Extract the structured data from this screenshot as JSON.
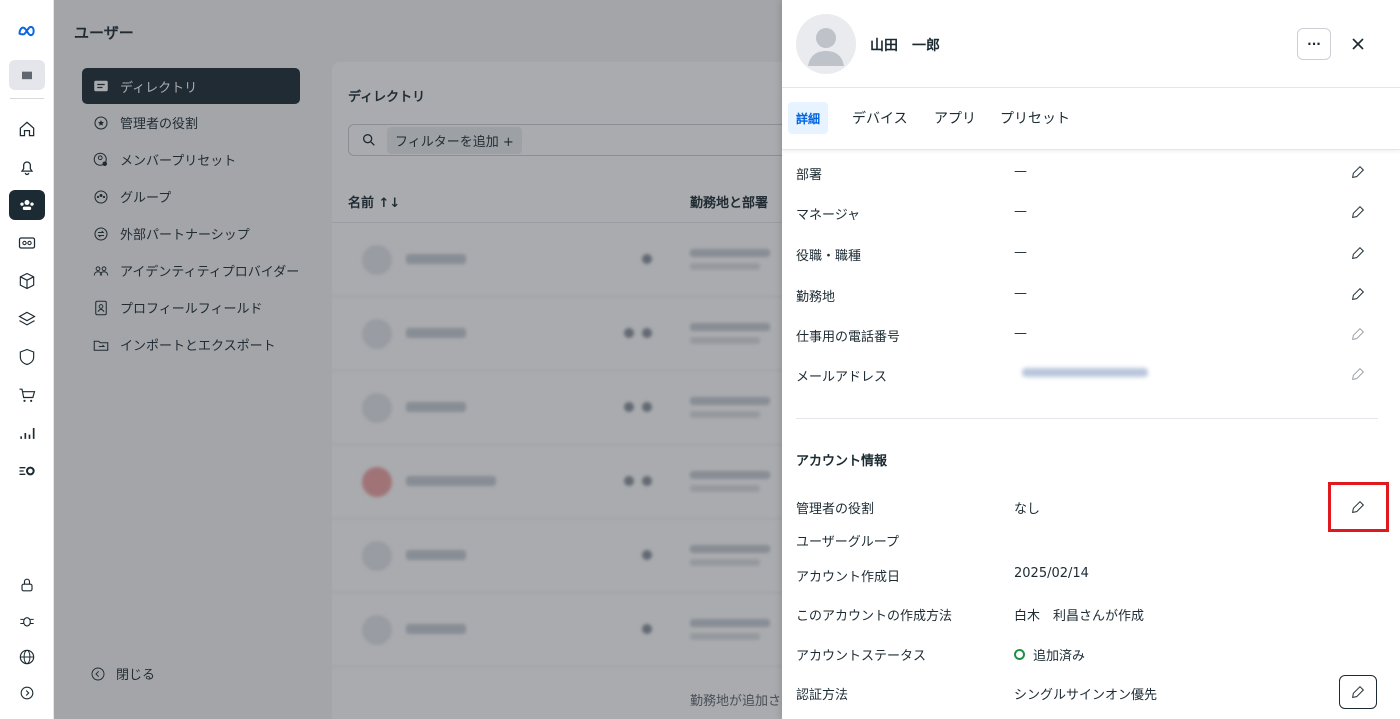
{
  "rail": {
    "icons": [
      "meta-logo-icon",
      "workspace-icon",
      "home-icon",
      "bell-icon",
      "users-icon",
      "billing-icon",
      "box-icon",
      "layers-icon",
      "shield-icon",
      "cart-icon",
      "analytics-icon",
      "settings-list-icon",
      "lock-icon",
      "bug-icon",
      "globe-icon",
      "expand-icon"
    ]
  },
  "header": {
    "title": "ユーザー"
  },
  "sidebar": {
    "items": [
      {
        "label": "ディレクトリ",
        "icon": "directory-icon"
      },
      {
        "label": "管理者の役割",
        "icon": "admin-role-icon"
      },
      {
        "label": "メンバープリセット",
        "icon": "member-preset-icon"
      },
      {
        "label": "グループ",
        "icon": "group-icon"
      },
      {
        "label": "外部パートナーシップ",
        "icon": "partnership-icon"
      },
      {
        "label": "アイデンティティプロバイダー",
        "icon": "identity-provider-icon"
      },
      {
        "label": "プロフィールフィールド",
        "icon": "profile-field-icon"
      },
      {
        "label": "インポートとエクスポート",
        "icon": "import-export-icon"
      }
    ],
    "close_label": "閉じる"
  },
  "directory": {
    "title": "ディレクトリ",
    "filter_label": "フィルターを追加 +",
    "columns": {
      "name": "名前 ↑↓",
      "location": "勤務地と部署"
    },
    "last_row_text": "勤務地が追加され"
  },
  "panel": {
    "user_name": "山田　一郎",
    "more_label": "···",
    "tabs": [
      "詳細",
      "デバイス",
      "アプリ",
      "プリセット"
    ],
    "fields": [
      {
        "label": "部署",
        "value": "—"
      },
      {
        "label": "マネージャ",
        "value": "—"
      },
      {
        "label": "役職・職種",
        "value": "—"
      },
      {
        "label": "勤務地",
        "value": "—"
      },
      {
        "label": "仕事用の電話番号",
        "value": "—"
      },
      {
        "label": "メールアドレス",
        "value": ""
      }
    ],
    "account_section": {
      "title": "アカウント情報",
      "fields": [
        {
          "label": "管理者の役割",
          "value": "なし"
        },
        {
          "label": "ユーザーグループ",
          "value": ""
        },
        {
          "label": "アカウント作成日",
          "value": "2025/02/14"
        },
        {
          "label": "このアカウントの作成方法",
          "value": "白木　利昌さんが作成"
        },
        {
          "label": "アカウントステータス",
          "value": "追加済み"
        },
        {
          "label": "認証方法",
          "value": "シングルサインオン優先"
        }
      ]
    }
  },
  "colors": {
    "accent": "#0064e0",
    "highlight": "#e0191e",
    "status_ok": "#1e8f4a",
    "dark": "#1c2b33"
  }
}
